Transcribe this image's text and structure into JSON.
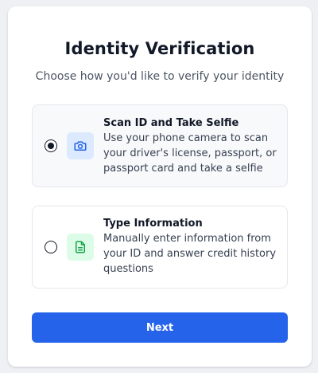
{
  "title": "Identity Verification",
  "subtitle": "Choose how you'd like to verify your identity",
  "options": [
    {
      "title": "Scan ID and Take Selfie",
      "description": "Use your phone camera to scan your driver's license, passport, or passport card and take a selfie",
      "icon": "camera-icon",
      "selected": true
    },
    {
      "title": "Type Information",
      "description": "Manually enter information from your ID and answer credit history questions",
      "icon": "document-icon",
      "selected": false
    }
  ],
  "next_label": "Next",
  "colors": {
    "accent": "#2563eb",
    "camera_icon_bg": "#dbeafe",
    "camera_icon": "#2563eb",
    "document_icon_bg": "#dcfce7",
    "document_icon": "#16a34a"
  }
}
